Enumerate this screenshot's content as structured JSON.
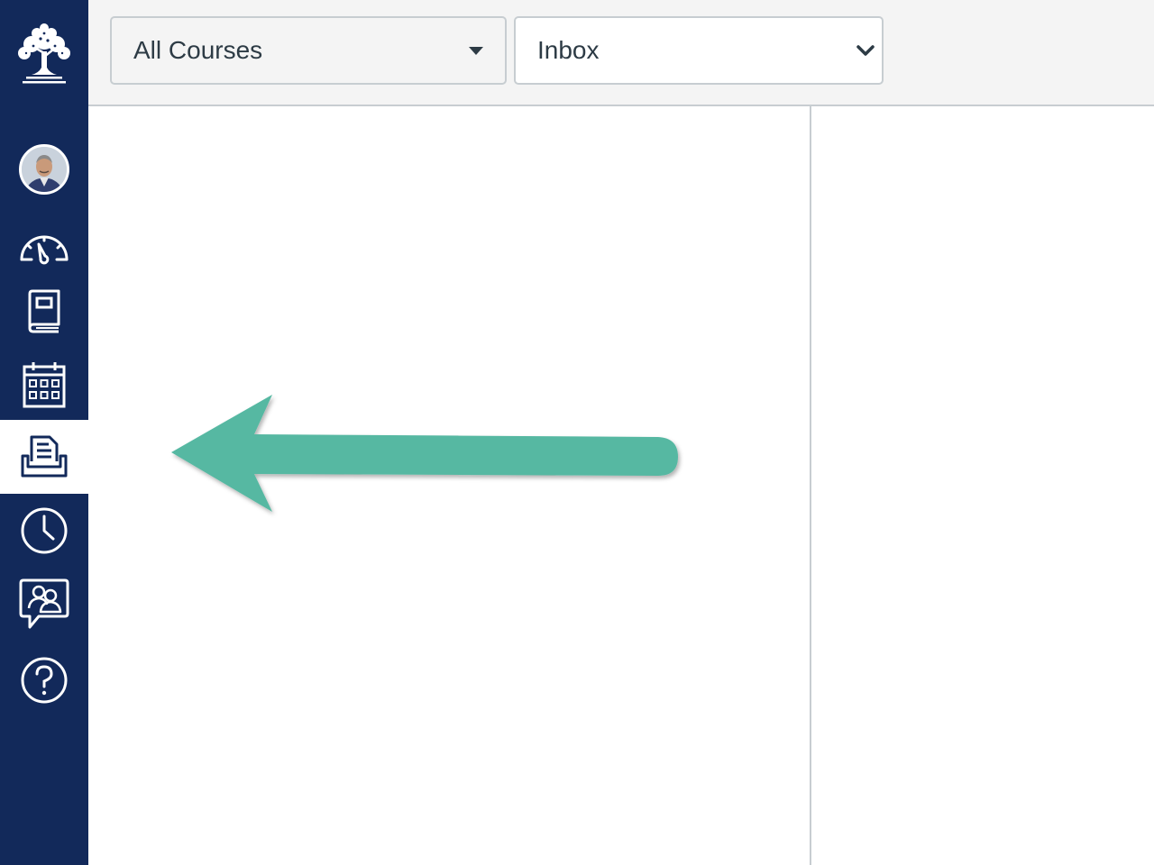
{
  "global_nav": {
    "logo_icon": "tree-seal-logo-icon",
    "items": [
      {
        "name": "account",
        "icon": "user-avatar"
      },
      {
        "name": "dashboard",
        "icon": "speedometer-icon"
      },
      {
        "name": "courses",
        "icon": "book-icon"
      },
      {
        "name": "calendar",
        "icon": "calendar-icon"
      },
      {
        "name": "inbox",
        "icon": "inbox-tray-icon",
        "active": true
      },
      {
        "name": "history",
        "icon": "clock-icon"
      },
      {
        "name": "commons",
        "icon": "people-chat-icon"
      },
      {
        "name": "help",
        "icon": "question-circle-icon"
      }
    ],
    "background_color": "#12295a",
    "active_background": "#ffffff"
  },
  "filters": {
    "course_select": {
      "value": "All Courses"
    },
    "mailbox_select": {
      "value": "Inbox"
    }
  },
  "annotation": {
    "icon": "left-arrow-callout-icon",
    "color": "#56b8a2"
  }
}
